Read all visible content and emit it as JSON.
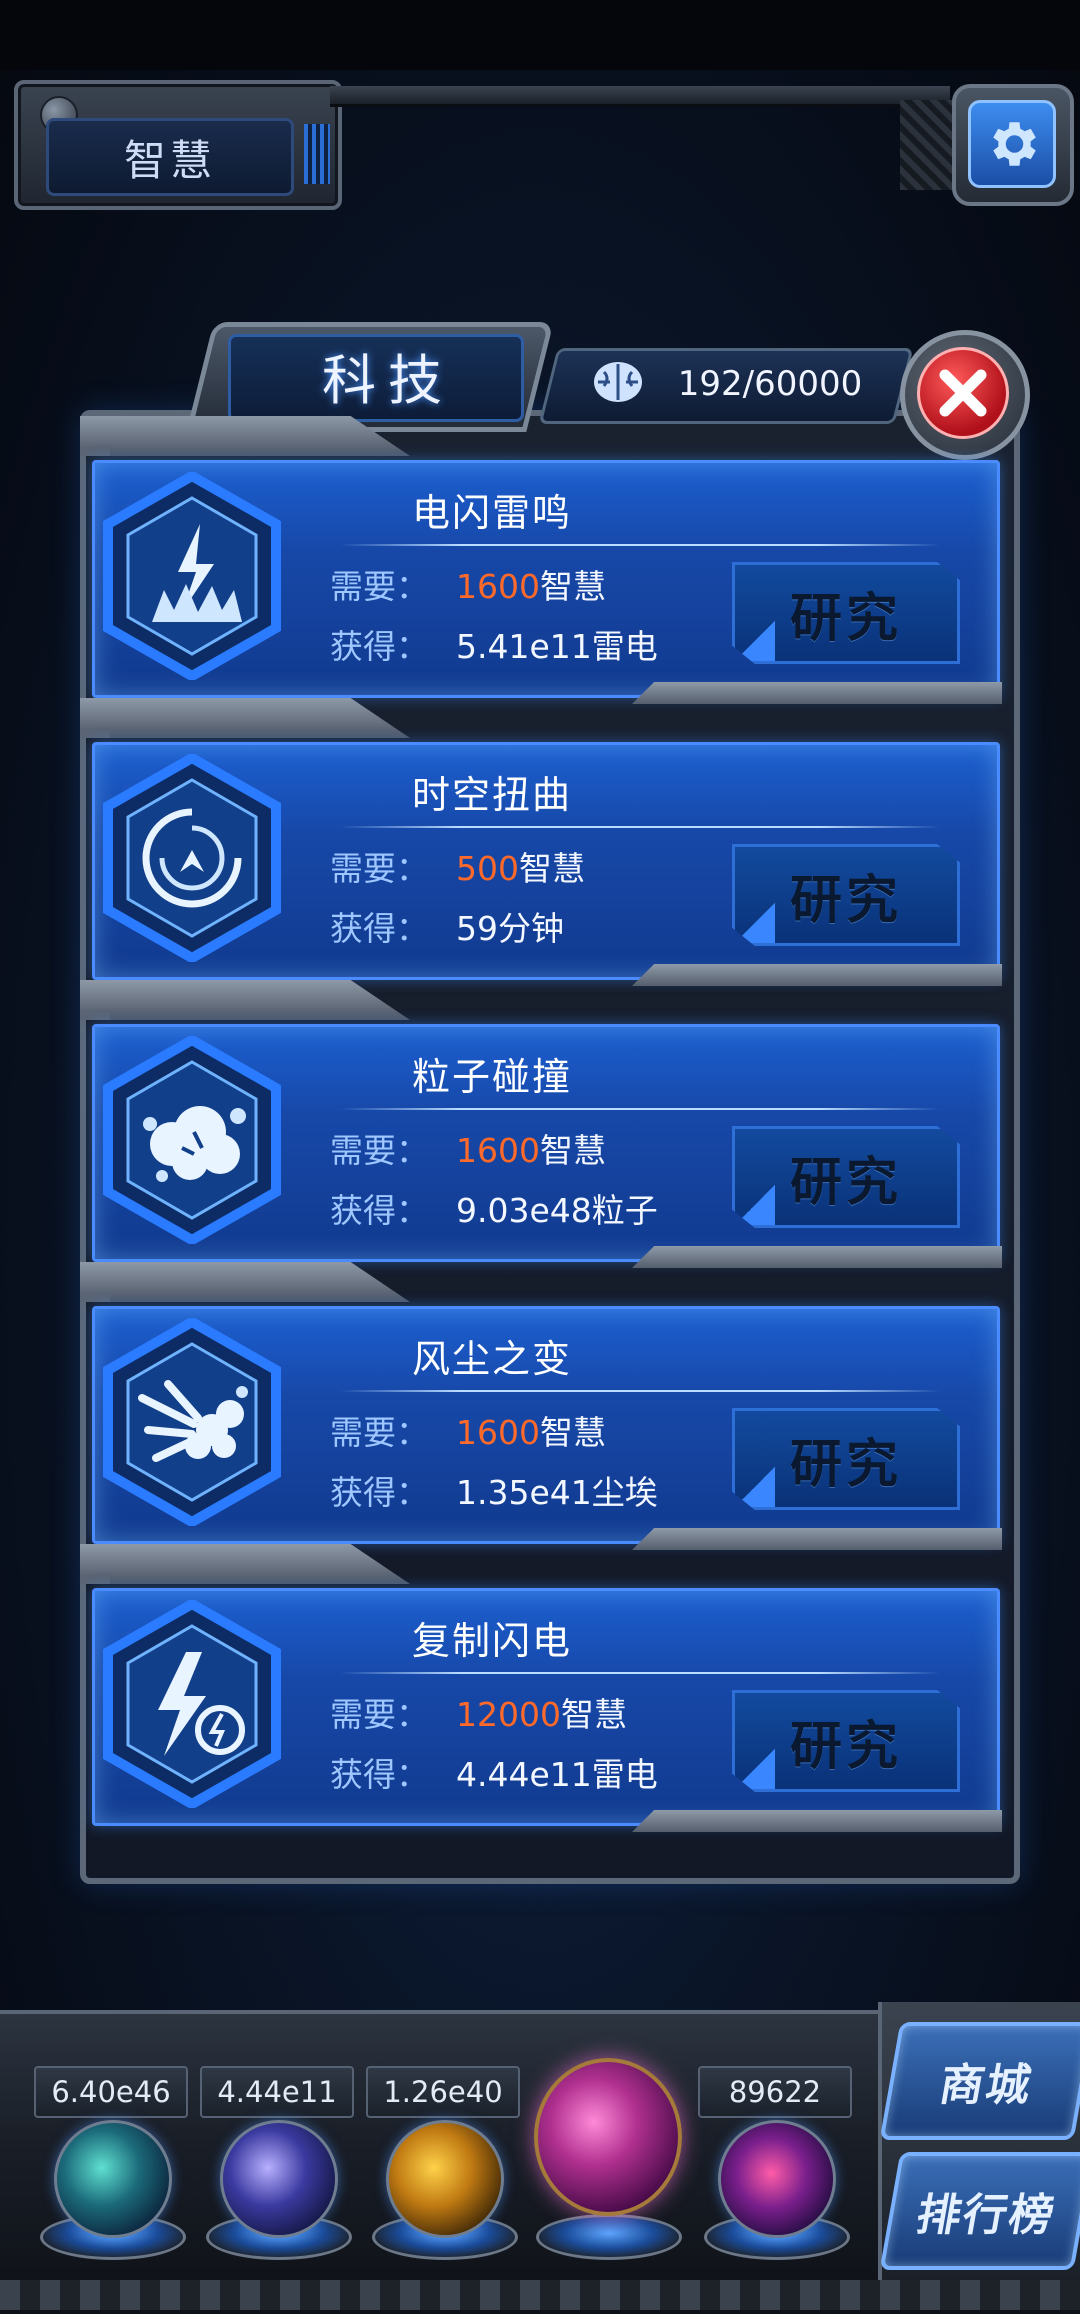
{
  "header": {
    "resource_label": "智慧"
  },
  "panel": {
    "title": "科技",
    "counter": "192/60000"
  },
  "techs": [
    {
      "name": "电闪雷鸣",
      "req_label": "需要：",
      "cost": "1600",
      "cost_unit": "智慧",
      "gain_label": "获得：",
      "gain": "5.41e11雷电",
      "button": "研究",
      "icon": "lightning-burst-icon"
    },
    {
      "name": "时空扭曲",
      "req_label": "需要：",
      "cost": "500",
      "cost_unit": "智慧",
      "gain_label": "获得：",
      "gain": "59分钟",
      "button": "研究",
      "icon": "vortex-icon"
    },
    {
      "name": "粒子碰撞",
      "req_label": "需要：",
      "cost": "1600",
      "cost_unit": "智慧",
      "gain_label": "获得：",
      "gain": "9.03e48粒子",
      "button": "研究",
      "icon": "particle-collision-icon"
    },
    {
      "name": "风尘之变",
      "req_label": "需要：",
      "cost": "1600",
      "cost_unit": "智慧",
      "gain_label": "获得：",
      "gain": "1.35e41尘埃",
      "button": "研究",
      "icon": "dust-storm-icon"
    },
    {
      "name": "复制闪电",
      "req_label": "需要：",
      "cost": "12000",
      "cost_unit": "智慧",
      "gain_label": "获得：",
      "gain": "4.44e11雷电",
      "button": "研究",
      "icon": "copy-lightning-icon"
    }
  ],
  "dock": {
    "resources": [
      "6.40e46",
      "4.44e11",
      "1.26e40",
      "",
      "89622"
    ],
    "shop_label": "商城",
    "ranking_label": "排行榜"
  },
  "colors": {
    "card_blue": "#1c5fd0",
    "cost_orange": "#ff6a2b",
    "label_blue": "#9ec6ff"
  }
}
